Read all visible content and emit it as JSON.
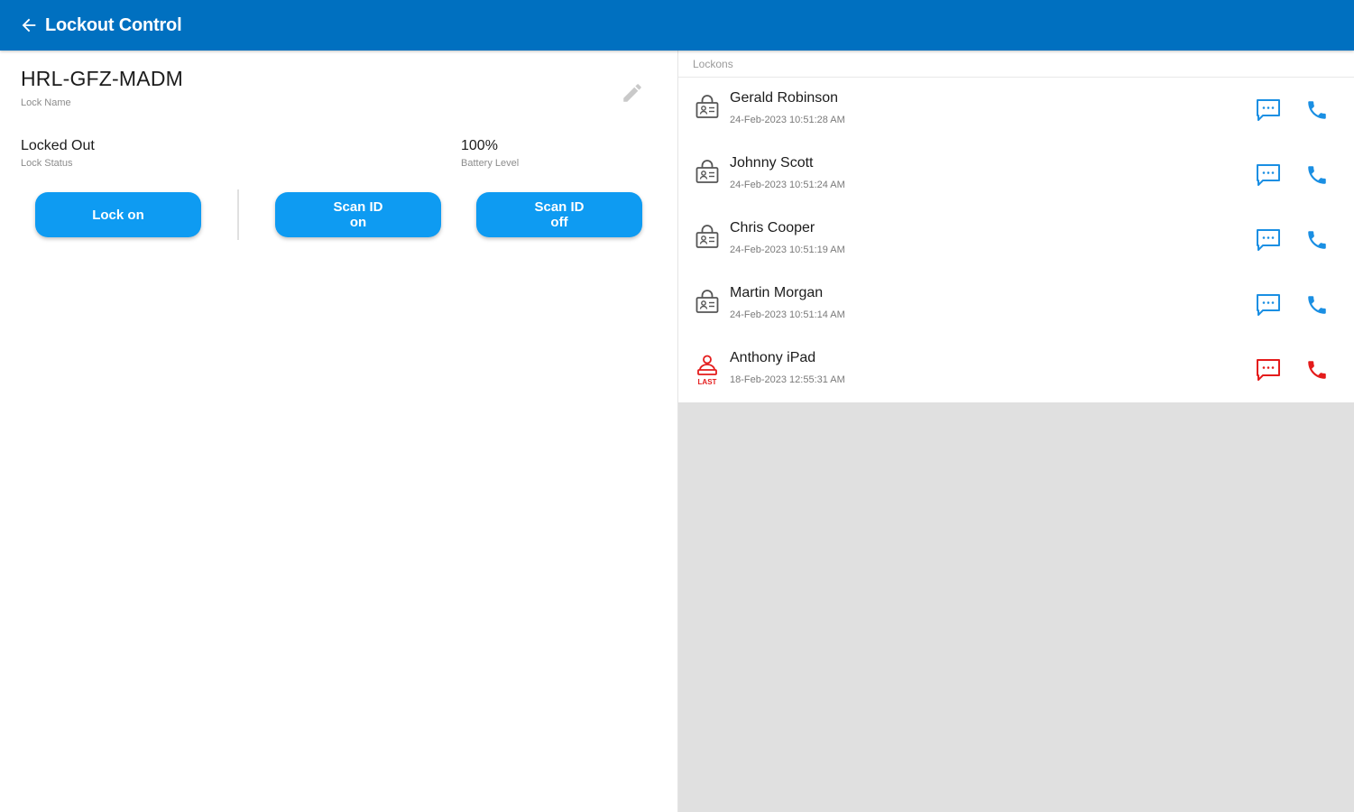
{
  "app_bar": {
    "title": "Lockout Control",
    "back_icon": "arrow-left-icon",
    "color": "#0070c0"
  },
  "lock": {
    "name": "HRL-GFZ-MADM",
    "name_caption": "Lock Name",
    "status": "Locked Out",
    "status_caption": "Lock Status",
    "battery": "100%",
    "battery_caption": "Battery Level",
    "edit_icon": "pencil-icon"
  },
  "actions": {
    "lock_on": "Lock on",
    "scan_id_on": "Scan ID\non",
    "scan_id_off": "Scan ID\noff",
    "button_color": "#0e9bf2"
  },
  "lockons": {
    "header": "Lockons",
    "items": [
      {
        "name": "Gerald Robinson",
        "time": "24-Feb-2023 10:51:28 AM",
        "icon": "lock-user-icon",
        "last": false
      },
      {
        "name": "Johnny Scott",
        "time": "24-Feb-2023 10:51:24 AM",
        "icon": "lock-user-icon",
        "last": false
      },
      {
        "name": "Chris Cooper",
        "time": "24-Feb-2023 10:51:19 AM",
        "icon": "lock-user-icon",
        "last": false
      },
      {
        "name": "Martin Morgan",
        "time": "24-Feb-2023 10:51:14 AM",
        "icon": "lock-user-icon",
        "last": false
      },
      {
        "name": "Anthony iPad",
        "time": "18-Feb-2023 12:55:31 AM",
        "icon": "last-user-icon",
        "last": true,
        "badge": "LAST"
      }
    ],
    "action_color": "#1a8fe3",
    "last_color": "#e41b1b"
  }
}
